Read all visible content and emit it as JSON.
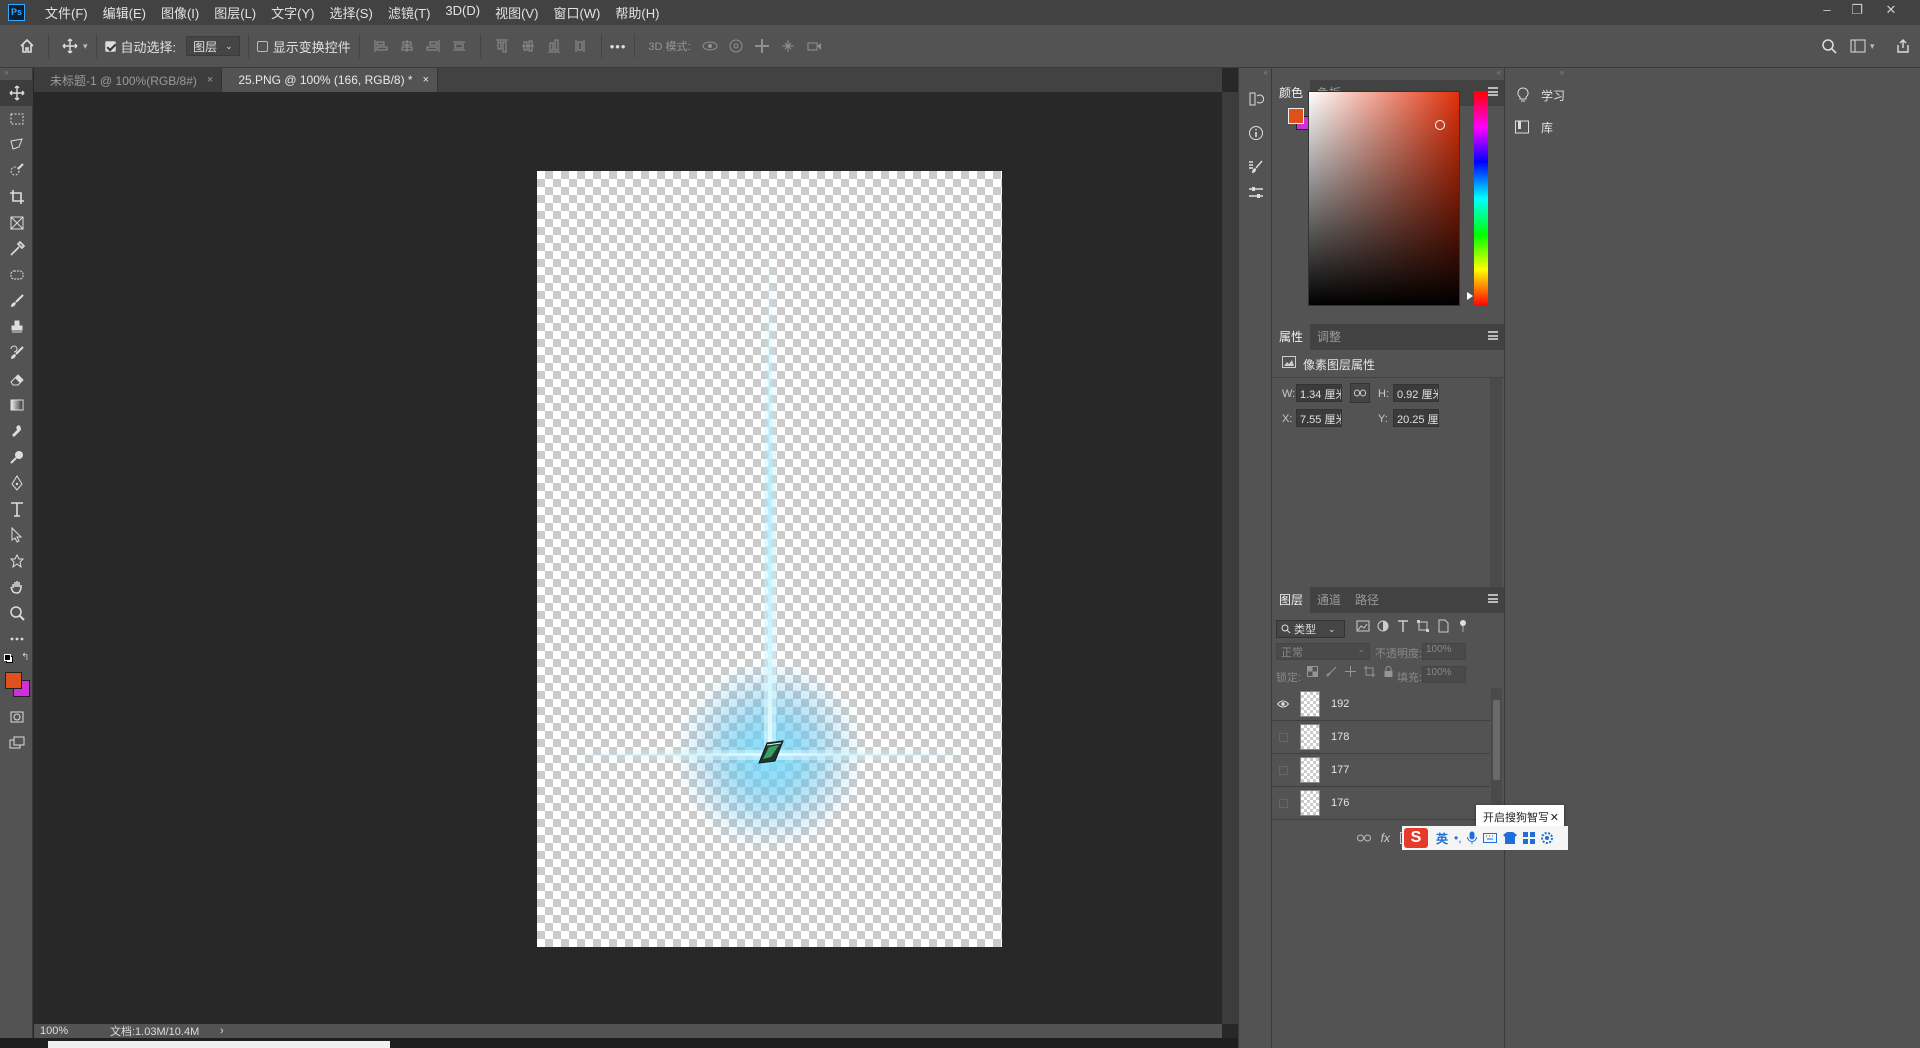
{
  "app": {
    "logo": "Ps"
  },
  "menu": [
    "文件(F)",
    "编辑(E)",
    "图像(I)",
    "图层(L)",
    "文字(Y)",
    "选择(S)",
    "滤镜(T)",
    "3D(D)",
    "视图(V)",
    "窗口(W)",
    "帮助(H)"
  ],
  "window_controls": {
    "minimize": "–",
    "restore": "❐",
    "close": "✕"
  },
  "options": {
    "auto_select_label": "自动选择:",
    "auto_select_checked": true,
    "auto_select_target": "图层",
    "show_transform_label": "显示变换控件",
    "show_transform_checked": false,
    "more": "•••",
    "mode_3d_label": "3D 模式:"
  },
  "doc_tabs": [
    {
      "label": "未标题-1 @ 100%(RGB/8#)",
      "close": "×",
      "active": false
    },
    {
      "label": "25.PNG @ 100% (166, RGB/8) *",
      "close": "×",
      "active": true
    }
  ],
  "status": {
    "zoom": "100%",
    "doc_info": "文档:1.03M/10.4M",
    "arrow": "›"
  },
  "color_panel": {
    "tabs": [
      "颜色",
      "色板"
    ],
    "foreground": "#e0501c",
    "background": "#d030d8"
  },
  "properties_panel": {
    "tabs": [
      "属性",
      "调整"
    ],
    "section": "像素图层属性",
    "w_label": "W:",
    "w_value": "1.34 厘米",
    "h_label": "H:",
    "h_value": "0.92 厘米",
    "x_label": "X:",
    "x_value": "7.55 厘米",
    "y_label": "Y:",
    "y_value": "20.25 厘米"
  },
  "layers_panel": {
    "tabs": [
      "图层",
      "通道",
      "路径"
    ],
    "filter_kind": "类型",
    "blend_mode": "正常",
    "opacity_label": "不透明度:",
    "opacity_value": "100%",
    "lock_label": "锁定:",
    "fill_label": "填充:",
    "fill_value": "100%",
    "layers": [
      {
        "name": "192",
        "visible": true
      },
      {
        "name": "178",
        "visible": false
      },
      {
        "name": "177",
        "visible": false
      },
      {
        "name": "176",
        "visible": false
      }
    ],
    "fx_label": "fx"
  },
  "right_panel": {
    "learn": "学习",
    "library": "库"
  },
  "ime": {
    "tooltip": "开启搜狗智写",
    "close": "✕",
    "lang": "英"
  }
}
